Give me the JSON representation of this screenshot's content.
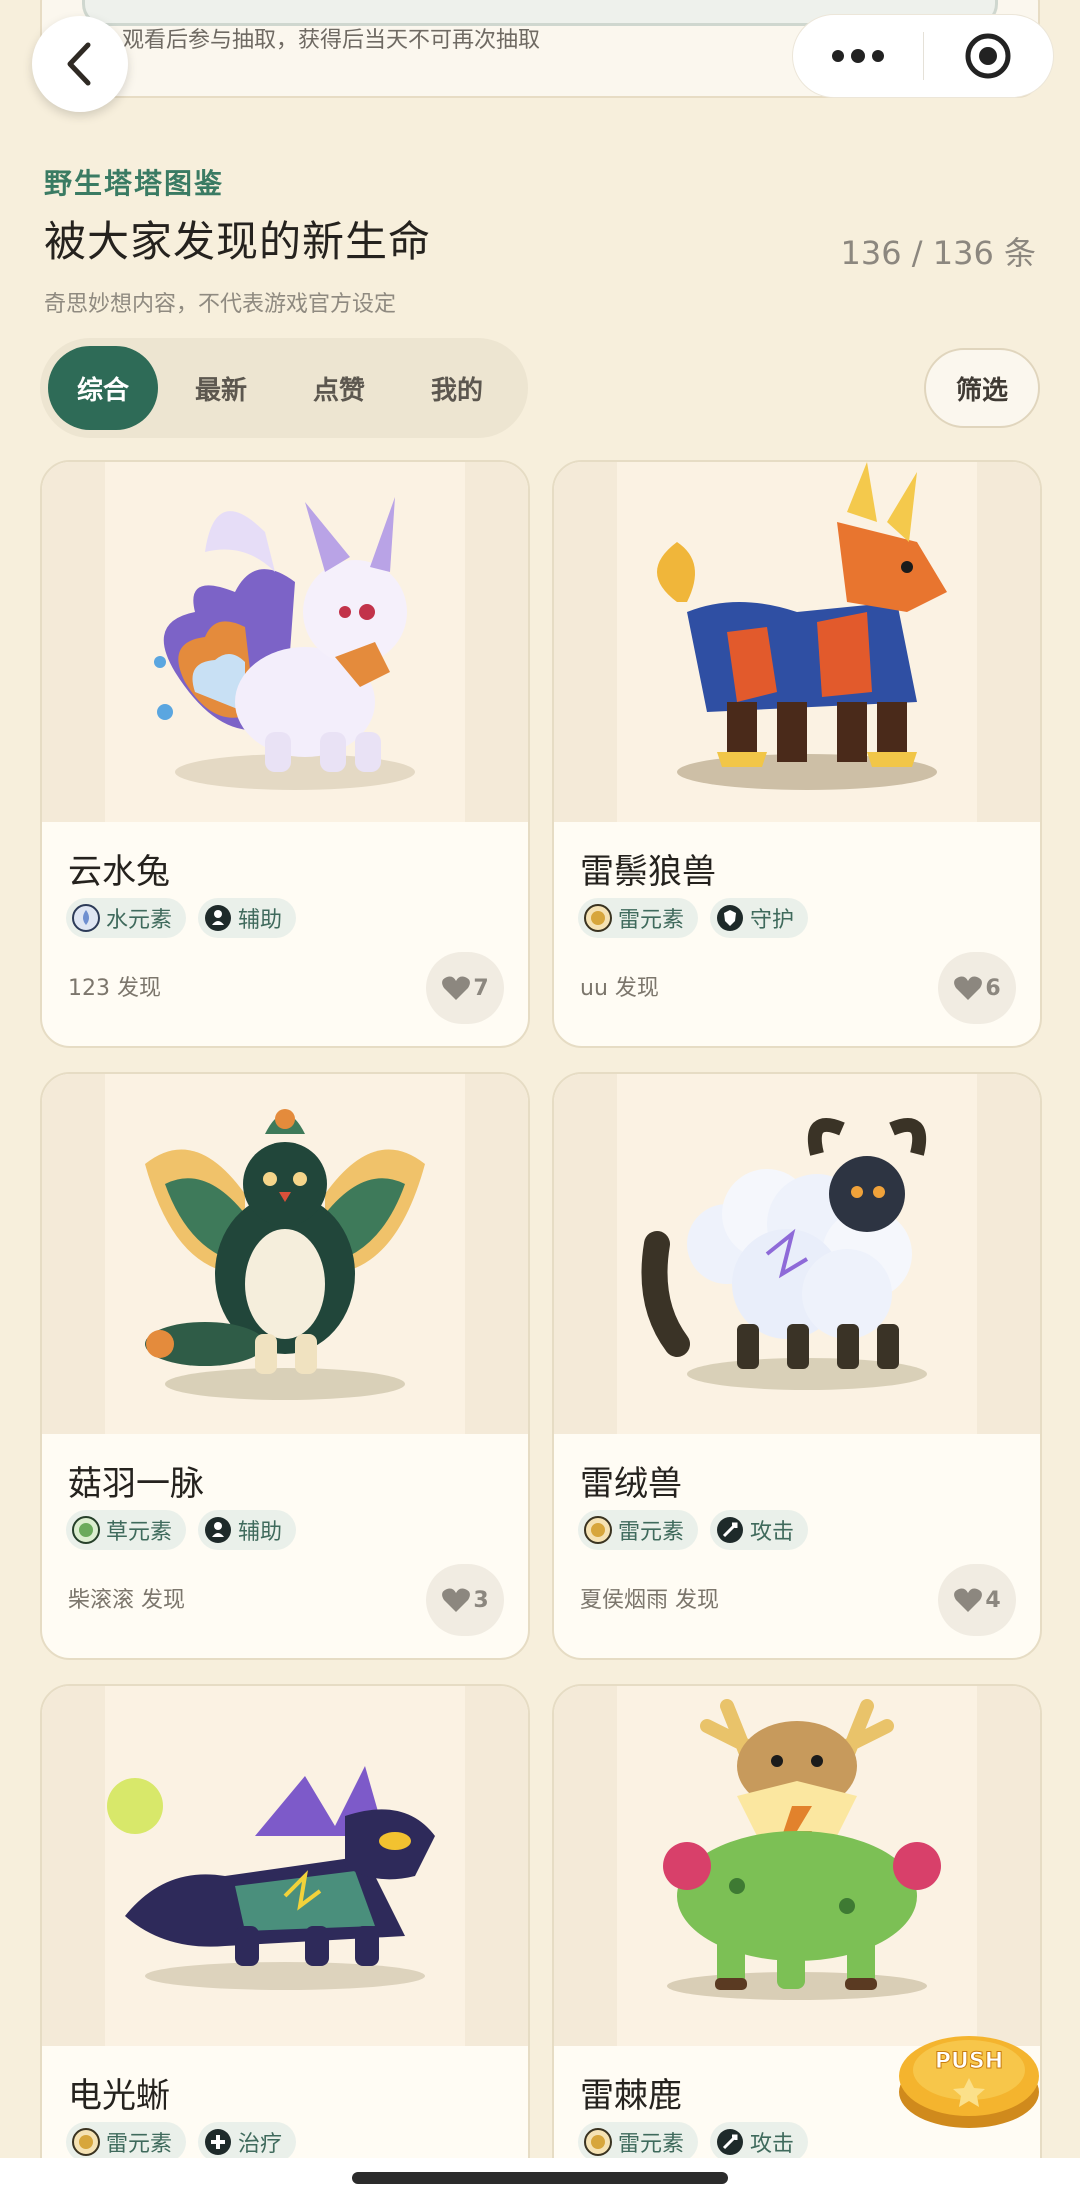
{
  "notice": {
    "text": "观看后参与抽取，获得后当天不可再次抽取"
  },
  "capsule": {
    "more_icon": "more-dots-icon",
    "close_icon": "target-icon"
  },
  "header": {
    "section_label": "野生塔塔图鉴",
    "title": "被大家发现的新生命",
    "counter": "136 / 136 条",
    "disclaimer": "奇思妙想内容，不代表游戏官方设定"
  },
  "tabs": [
    {
      "label": "综合",
      "active": true
    },
    {
      "label": "最新",
      "active": false
    },
    {
      "label": "点赞",
      "active": false
    },
    {
      "label": "我的",
      "active": false
    }
  ],
  "filter_label": "筛选",
  "cards": [
    {
      "name": "云水兔",
      "element": "水元素",
      "role": "辅助",
      "finder": "123 发现",
      "likes": "7",
      "element_color": "#7a92c9"
    },
    {
      "name": "雷鬃狼兽",
      "element": "雷元素",
      "role": "守护",
      "finder": "uu 发现",
      "likes": "6",
      "element_color": "#d7a63c"
    },
    {
      "name": "菇羽一脉",
      "element": "草元素",
      "role": "辅助",
      "finder": "柴滚滚 发现",
      "likes": "3",
      "element_color": "#6aaa5b"
    },
    {
      "name": "雷绒兽",
      "element": "雷元素",
      "role": "攻击",
      "finder": "夏侯烟雨 发现",
      "likes": "4",
      "element_color": "#d7a63c"
    },
    {
      "name": "电光蜥",
      "element": "雷元素",
      "role": "治疗",
      "finder": "",
      "likes": "",
      "element_color": "#d7a63c"
    },
    {
      "name": "雷棘鹿",
      "element": "雷元素",
      "role": "攻击",
      "finder": "",
      "likes": "",
      "element_color": "#d7a63c"
    }
  ],
  "push_button": {
    "label": "PUSH"
  },
  "colors": {
    "accent": "#2e6b57",
    "background": "#f7efdc",
    "section_label": "#3a7b63"
  }
}
